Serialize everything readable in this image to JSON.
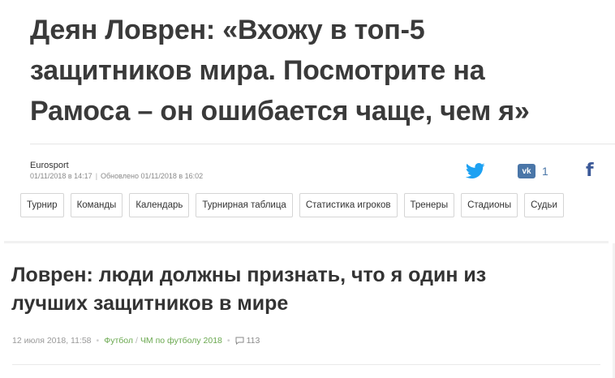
{
  "headline": {
    "lines": [
      "Деян Ловрен: «Вхожу в топ-5",
      "защитников мира. Посмотрите на",
      "Рамоса – он ошибается чаще, чем я»"
    ]
  },
  "article_meta": {
    "source": "Eurosport",
    "published": "01/11/2018 в 14:17",
    "updated": "Обновлено 01/11/2018 в 16:02"
  },
  "share": {
    "twitter_icon": "twitter-bird-icon",
    "vk_icon": "vk-icon",
    "vk_label": "vk",
    "vk_count": "1",
    "facebook_icon": "facebook-icon",
    "facebook_glyph": "f",
    "colors": {
      "twitter": "#1da1f2",
      "vk": "#4a76a8",
      "facebook": "#3b5998"
    }
  },
  "tabs": [
    "Турнир",
    "Команды",
    "Календарь",
    "Турнирная таблица",
    "Статистика игроков",
    "Тренеры",
    "Стадионы",
    "Судьи"
  ],
  "card": {
    "title_lines": [
      "Ловрен: люди должны признать, что я один из",
      "лучших защитников в мире"
    ],
    "date": "12 июля 2018, 11:58",
    "category": "Футбол",
    "subcategory": "ЧМ по футболу 2018",
    "comment_icon": "comment-icon",
    "comments": "113",
    "category_color": "#6aa84f"
  }
}
